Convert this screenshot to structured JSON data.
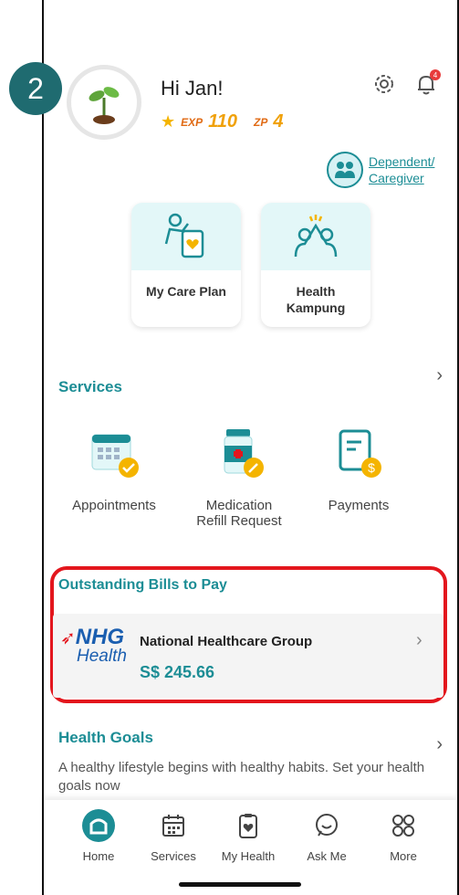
{
  "step": {
    "number": "2"
  },
  "profile": {
    "greeting": "Hi Jan!",
    "exp_label": "EXP",
    "exp_value": "110",
    "zp_label": "ZP",
    "zp_value": "4"
  },
  "header": {
    "notification_count": "4"
  },
  "dependent": {
    "line1": "Dependent/",
    "line2": "Caregiver"
  },
  "quick_cards": [
    {
      "label": "My Care Plan"
    },
    {
      "label_line1": "Health",
      "label_line2": "Kampung"
    }
  ],
  "services": {
    "title": "Services",
    "items": [
      {
        "label": "Appointments"
      },
      {
        "label_line1": "Medication",
        "label_line2": "Refill Request"
      },
      {
        "label": "Payments"
      }
    ]
  },
  "bills": {
    "title": "Outstanding Bills to Pay",
    "logo_top": "NHG",
    "logo_bottom": "Health",
    "provider": "National Healthcare Group",
    "amount": "S$ 245.66"
  },
  "goals": {
    "title": "Health Goals",
    "text": "A healthy lifestyle begins with healthy habits. Set your health goals now"
  },
  "nav": {
    "items": [
      {
        "label": "Home"
      },
      {
        "label": "Services"
      },
      {
        "label": "My Health"
      },
      {
        "label": "Ask Me"
      },
      {
        "label": "More"
      }
    ]
  },
  "colors": {
    "accent": "#1c8d95",
    "highlight": "#e3161d",
    "step_badge": "#1f6b70"
  },
  "icons": [
    "sprout-icon",
    "star-icon",
    "gear-icon",
    "bell-icon",
    "family-icon",
    "care-plan-icon",
    "high-five-icon",
    "calendar-icon",
    "medicine-bottle-icon",
    "invoice-icon",
    "home-icon",
    "calendar-nav-icon",
    "clipboard-heart-icon",
    "chat-icon",
    "grid-icon"
  ]
}
